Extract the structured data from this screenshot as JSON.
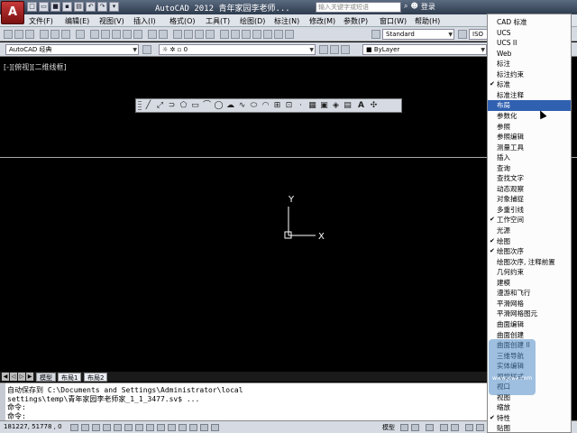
{
  "titlebar": {
    "app_button": "A",
    "title": "AutoCAD 2012   青年家园李老师...",
    "search_placeholder": "输入关键字或短语",
    "login": "登录"
  },
  "menubar": {
    "items": [
      "文件(F)",
      "编辑(E)",
      "视图(V)",
      "插入(I)",
      "格式(O)",
      "工具(T)",
      "绘图(D)",
      "标注(N)",
      "修改(M)",
      "参数(P)",
      "窗口(W)",
      "帮助(H)"
    ]
  },
  "toolbar1": {
    "text_style": "Standard",
    "dim_style": "ISO"
  },
  "toolbar2": {
    "workspace": "AutoCAD 经典",
    "layer": "0",
    "color": "ByLayer"
  },
  "drawing": {
    "viewport_label": "[-][俯视][二维线框]",
    "ucs_y": "Y",
    "ucs_x": "X"
  },
  "layout_tabs": [
    "模型",
    "布局1",
    "布局2"
  ],
  "command": {
    "lines": [
      "自动保存到 C:\\Documents and Settings\\Administrator\\local",
      "settings\\temp\\青年家园李老师家_1_1_3477.sv$ ...",
      "命令:",
      "命令:"
    ]
  },
  "statusbar": {
    "coords": "181227, 51778 , 0",
    "model": "模型"
  },
  "context_menu": {
    "items": [
      {
        "label": "CAD 标准",
        "checked": false,
        "selected": false
      },
      {
        "label": "UCS",
        "checked": false,
        "selected": false
      },
      {
        "label": "UCS II",
        "checked": false,
        "selected": false
      },
      {
        "label": "Web",
        "checked": false,
        "selected": false
      },
      {
        "label": "标注",
        "checked": false,
        "selected": false
      },
      {
        "label": "标注约束",
        "checked": false,
        "selected": false
      },
      {
        "label": "标准",
        "checked": true,
        "selected": false
      },
      {
        "label": "标准注释",
        "checked": false,
        "selected": false
      },
      {
        "label": "布局",
        "checked": false,
        "selected": true
      },
      {
        "label": "参数化",
        "checked": false,
        "selected": false
      },
      {
        "label": "参照",
        "checked": false,
        "selected": false
      },
      {
        "label": "参照编辑",
        "checked": false,
        "selected": false
      },
      {
        "label": "测量工具",
        "checked": false,
        "selected": false
      },
      {
        "label": "插入",
        "checked": false,
        "selected": false
      },
      {
        "label": "查询",
        "checked": false,
        "selected": false
      },
      {
        "label": "查找文字",
        "checked": false,
        "selected": false
      },
      {
        "label": "动态观察",
        "checked": false,
        "selected": false
      },
      {
        "label": "对象捕捉",
        "checked": false,
        "selected": false
      },
      {
        "label": "多重引线",
        "checked": false,
        "selected": false
      },
      {
        "label": "工作空间",
        "checked": true,
        "selected": false
      },
      {
        "label": "光源",
        "checked": false,
        "selected": false
      },
      {
        "label": "绘图",
        "checked": true,
        "selected": false
      },
      {
        "label": "绘图次序",
        "checked": true,
        "selected": false
      },
      {
        "label": "绘图次序, 注释前置",
        "checked": false,
        "selected": false
      },
      {
        "label": "几何约束",
        "checked": false,
        "selected": false
      },
      {
        "label": "建模",
        "checked": false,
        "selected": false
      },
      {
        "label": "漫游和飞行",
        "checked": false,
        "selected": false
      },
      {
        "label": "平滑网格",
        "checked": false,
        "selected": false
      },
      {
        "label": "平滑网格图元",
        "checked": false,
        "selected": false
      },
      {
        "label": "曲面编辑",
        "checked": false,
        "selected": false
      },
      {
        "label": "曲面创建",
        "checked": false,
        "selected": false
      },
      {
        "label": "曲面创建 II",
        "checked": false,
        "selected": false
      },
      {
        "label": "三维导航",
        "checked": false,
        "selected": false
      },
      {
        "label": "实体编辑",
        "checked": false,
        "selected": false
      },
      {
        "label": "视觉样式",
        "checked": false,
        "selected": false
      },
      {
        "label": "视口",
        "checked": false,
        "selected": false
      },
      {
        "label": "视图",
        "checked": false,
        "selected": false
      },
      {
        "label": "缩放",
        "checked": false,
        "selected": false
      },
      {
        "label": "特性",
        "checked": true,
        "selected": false
      },
      {
        "label": "贴图",
        "checked": false,
        "selected": false
      }
    ]
  },
  "watermark": "www.jcwx.com"
}
